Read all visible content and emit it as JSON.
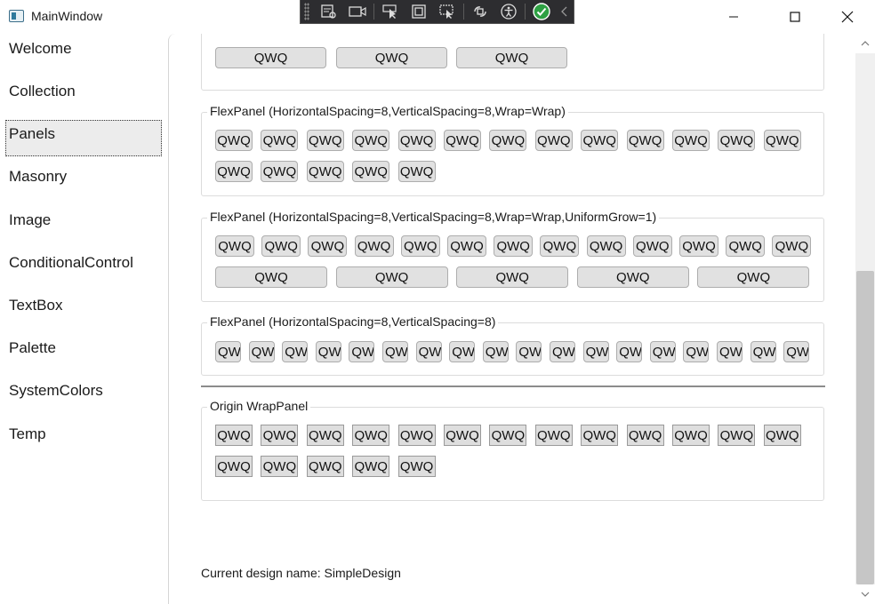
{
  "window": {
    "title": "MainWindow",
    "icon": "app-window-icon",
    "minimize_icon": "minimize-icon",
    "maximize_icon": "maximize-icon",
    "close_icon": "close-icon"
  },
  "debug_toolbar": {
    "tools": [
      "live-visual-tree-icon",
      "record-icon",
      "select-element-icon",
      "display-layout-adorners-icon",
      "track-focus-icon",
      "binding-failures-icon",
      "accessibility-icon",
      "checkmark-status-icon",
      "collapse-chevron-icon"
    ]
  },
  "nav": {
    "items": [
      {
        "label": "Welcome"
      },
      {
        "label": "Collection"
      },
      {
        "label": "Panels",
        "selected": true
      },
      {
        "label": "Masonry"
      },
      {
        "label": "Image"
      },
      {
        "label": "ConditionalControl"
      },
      {
        "label": "TextBox"
      },
      {
        "label": "Palette"
      },
      {
        "label": "SystemColors"
      },
      {
        "label": "Temp"
      }
    ]
  },
  "button_label": "QWQ",
  "clipped_button_label": "QW",
  "groups": [
    {
      "label": "FlexPanel (HorizontalSpacing=8,VerticalSpacing=8,Wrap=Wrap)"
    },
    {
      "label": "FlexPanel (HorizontalSpacing=8,VerticalSpacing=8,Wrap=Wrap,UniformGrow=1)"
    },
    {
      "label": "FlexPanel (HorizontalSpacing=8,VerticalSpacing=8)"
    },
    {
      "label": "Origin WrapPanel"
    }
  ],
  "footer": {
    "text": "Current design name: SimpleDesign"
  },
  "scroll": {
    "position_fraction": 0.44,
    "visible_fraction": 0.59
  },
  "colors": {
    "button_face": "#e1e1e1",
    "button_border": "#adadad",
    "debug_toolbar_bg": "#2d2d30",
    "status_ok": "#2ea043"
  }
}
